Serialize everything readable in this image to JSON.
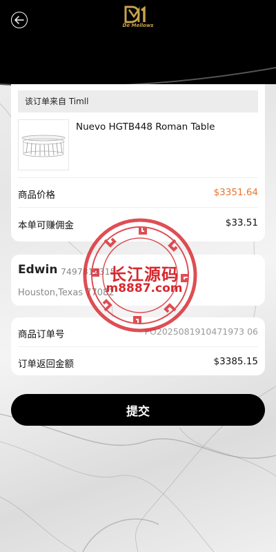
{
  "header": {
    "logo_text": "De Mellows"
  },
  "order": {
    "source": "该订单来自 Timll",
    "product_title": "Nuevo HGTB448 Roman Table",
    "price_label": "商品价格",
    "price_value": "$3351.64",
    "commission_label": "本单可赚佣金",
    "commission_value": "$33.51"
  },
  "customer": {
    "name": "Edwin",
    "phone": "7497812315",
    "address": "Houston,Texas 77082"
  },
  "summary": {
    "order_no_label": "商品订单号",
    "order_no_value": "PO2025081910471973 06",
    "refund_label": "订单返回金额",
    "refund_value": "$3385.15"
  },
  "submit_label": "提交",
  "watermark": {
    "line1": "长江源码",
    "line2": "m8887.com"
  },
  "colors": {
    "accent": "#e8732d",
    "brand_gold": "#c9a24c",
    "stamp_red": "#d7282f"
  }
}
